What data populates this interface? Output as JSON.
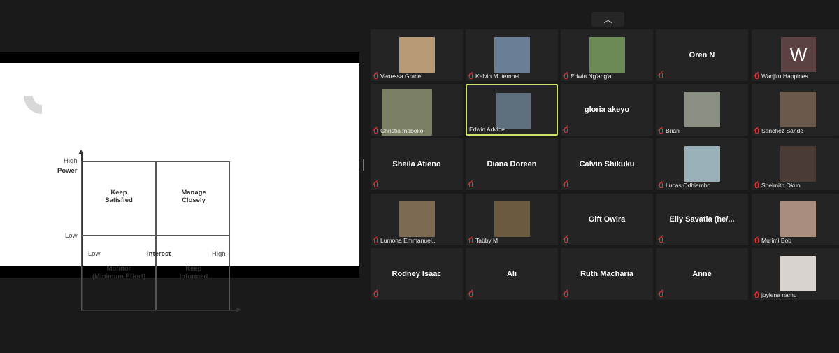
{
  "share": {
    "matrix": {
      "quadrants": {
        "top_left": "Keep\nSatisfied",
        "top_right": "Manage\nClosely",
        "bottom_left": "Monitor\n(Minimum Effort)",
        "bottom_right": "Keep\nInformed"
      },
      "y_axis": {
        "title": "Power",
        "high": "High",
        "low": "Low"
      },
      "x_axis": {
        "title": "Interest",
        "low": "Low",
        "high": "High"
      }
    }
  },
  "gallery": {
    "collapse_icon": "chevron-up",
    "participants": [
      {
        "name": "Venessa Grace",
        "video": true,
        "muted": true,
        "photo_color": "#b89a76"
      },
      {
        "name": "Kelvin Mutembei",
        "video": true,
        "muted": true,
        "photo_color": "#6a7f96"
      },
      {
        "name": "Edwin Ng'ang'a",
        "video": true,
        "muted": true,
        "photo_color": "#6c8a56"
      },
      {
        "name": "Oren N",
        "video": false,
        "muted": true
      },
      {
        "name": "Wanjiru Happines",
        "video": false,
        "muted": true,
        "avatar_letter": "W",
        "avatar_color": "#5b4141"
      },
      {
        "name": "Christia maboko",
        "video": true,
        "muted": true,
        "photo_color": "#7b7f63"
      },
      {
        "name": "Edwin Advine",
        "video": true,
        "muted": false,
        "active": true,
        "photo_color": "#5f6f7d"
      },
      {
        "name": "gloria akeyo",
        "video": false,
        "muted": true
      },
      {
        "name": "Brian",
        "video": true,
        "muted": true,
        "photo_color": "#8a8f84"
      },
      {
        "name": "Sanchez Sande",
        "video": true,
        "muted": true,
        "photo_color": "#6a5a4c"
      },
      {
        "name": "Sheila Atieno",
        "video": false,
        "muted": true
      },
      {
        "name": "Diana Doreen",
        "video": false,
        "muted": true
      },
      {
        "name": "Calvin Shikuku",
        "video": false,
        "muted": true
      },
      {
        "name": "Lucas Odhiambo",
        "video": true,
        "muted": true,
        "photo_color": "#9ab0b8"
      },
      {
        "name": "Shelmith Okun",
        "video": true,
        "muted": true,
        "photo_color": "#4a3c34"
      },
      {
        "name": "Lumona Emmanuel...",
        "video": true,
        "muted": true,
        "photo_color": "#7d6a52"
      },
      {
        "name": "Tabby M",
        "video": true,
        "muted": true,
        "photo_color": "#6b5a3d"
      },
      {
        "name": "Gift Owira",
        "video": false,
        "muted": true
      },
      {
        "name": "Elly Savatia  (he/...",
        "video": false,
        "muted": true
      },
      {
        "name": "Murimi Bob",
        "video": true,
        "muted": true,
        "photo_color": "#a98d7d"
      },
      {
        "name": "Rodney Isaac",
        "video": false,
        "muted": true
      },
      {
        "name": "Ali",
        "video": false,
        "muted": true
      },
      {
        "name": "Ruth Macharia",
        "video": false,
        "muted": true
      },
      {
        "name": "Anne",
        "video": false,
        "muted": true
      },
      {
        "name": "joylena namu",
        "video": true,
        "muted": true,
        "photo_color": "#d9d3cf"
      }
    ]
  },
  "colors": {
    "active_speaker": "#cde26a",
    "muted_icon": "#e03030",
    "tile_bg": "#242424"
  }
}
